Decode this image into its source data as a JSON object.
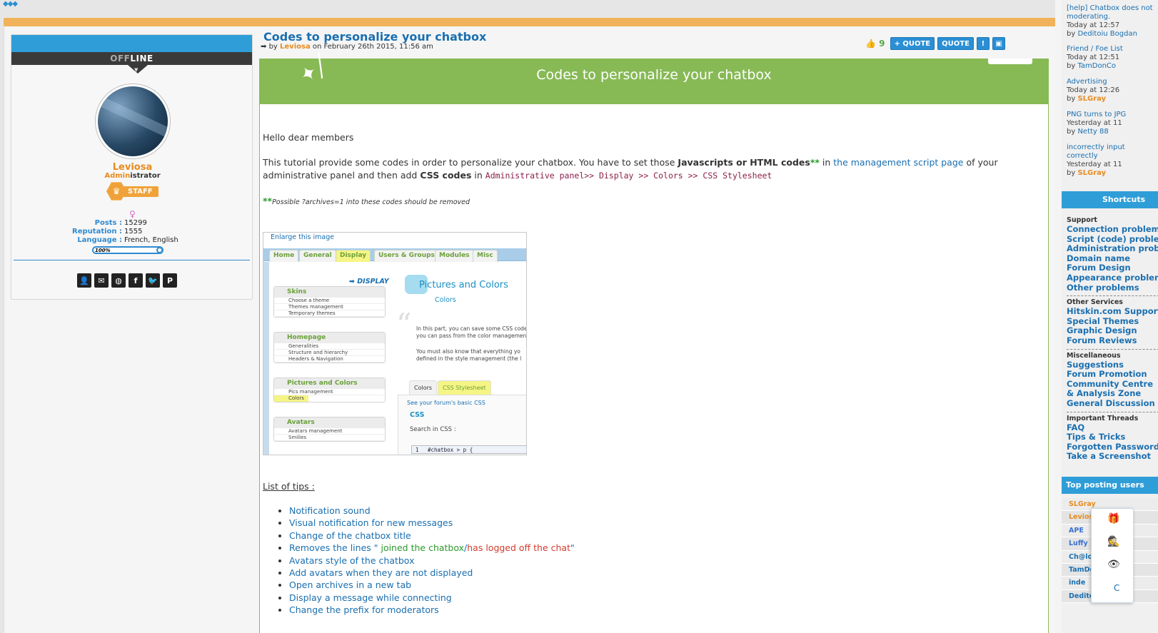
{
  "nav": {
    "arrows": "◆◆◆"
  },
  "profile": {
    "status_prefix": "OFF",
    "status_suffix": "LINE",
    "username": "Leviosa",
    "role_prefix": "Admin",
    "role_suffix": "istrator",
    "badge": "STAFF",
    "gender_symbol": "♀",
    "stats": [
      {
        "key": "Posts :",
        "value": "15299"
      },
      {
        "key": "Reputation :",
        "value": "1555"
      },
      {
        "key": "Language :",
        "value": "French, English"
      }
    ],
    "progress_label": "100%",
    "progress": 1.0,
    "socials": [
      "profile-icon",
      "email-icon",
      "website-icon",
      "facebook-icon",
      "twitter-icon",
      "pinterest-icon"
    ]
  },
  "post": {
    "title": "Codes to personalize your chatbox",
    "meta_by": "by",
    "author": "Leviosa",
    "date": "on February 26th 2015, 11:56 am",
    "like_count": "9",
    "multiquote_label": "+ QUOTE",
    "quote_label": "QUOTE",
    "report_label": "!",
    "banner_title": "Codes to personalize your chatbox",
    "greeting": "Hello dear members",
    "intro_1": "This tutorial provide some codes in order to personalize your chatbox. You have to set those ",
    "intro_bold": "Javascripts or HTML codes",
    "intro_stars": "**",
    "intro_in": " in ",
    "intro_link": "the management script page",
    "intro_2": " of your",
    "intro_3": "administrative panel and then add ",
    "intro_css": "CSS codes",
    "intro_in2": " in ",
    "intro_path": "Administrative panel>> Display >> Colors >> CSS Stylesheet",
    "note_stars": "**",
    "note_1": "Possible ",
    "note_code": "?archives=1",
    "note_2": " into these codes should be removed",
    "tips_heading": "List of tips :",
    "tips": [
      "Notification sound",
      "Visual notification for new messages",
      "Change of the chatbox title",
      "Avatars style of the chatbox",
      "Add avatars when they are not displayed",
      "Open archives in a new tab",
      "Display a message while connecting",
      "Change the prefix for moderators"
    ],
    "tip_removes_1": "Removes the lines \" ",
    "tip_removes_joined": "joined the chatbox",
    "tip_removes_sep": "/",
    "tip_removes_off": "has logged off the chat",
    "tip_removes_end": "\""
  },
  "screenshot": {
    "enlarge": "Enlarge this image",
    "tabs": [
      "Home",
      "General",
      "Display",
      "Users & Groups",
      "Modules",
      "Misc"
    ],
    "display_label": "➡ DISPLAY",
    "sections": [
      {
        "title": "Skins",
        "items": [
          "Choose a theme",
          "Themes management",
          "Temporary themes"
        ]
      },
      {
        "title": "Homepage",
        "items": [
          "Generalities",
          "Structure and hierarchy",
          "Headers & Navigation"
        ]
      },
      {
        "title": "Pictures and Colors",
        "items": [
          "Pics management",
          "Colors"
        ]
      },
      {
        "title": "Avatars",
        "items": [
          "Avatars management",
          "Smilies"
        ]
      }
    ],
    "heading": "Pictures and Colors",
    "sub": "Colors",
    "para1a": "In this part, you can save some CSS code",
    "para1b": "you can pass from the color managemen",
    "para2a": "You must also know that everything yo",
    "para2b": "defined in the style management (the l",
    "subtab1": "Colors",
    "subtab2": "CSS Stylesheet",
    "see_css": "See your forum's basic CSS",
    "css_label": "CSS",
    "search_css": "Search in CSS :",
    "code_line": "#chatbox > p {",
    "line_no": "1"
  },
  "sidebar": {
    "topics": [
      {
        "title": "[help] Chatbox does not moderating.",
        "when": "Today at 12:57",
        "by": "Deditoiu Bogdan",
        "author_color": "blue"
      },
      {
        "title": "Friend / Foe List",
        "when": "Today at 12:51",
        "by": "TamDonCo",
        "author_color": "blue"
      },
      {
        "title": "Advertising",
        "when": "Today at 12:26",
        "by": "SLGray",
        "author_color": "orange"
      },
      {
        "title": "PNG turns to JPG",
        "when": "Yesterday at 11",
        "by": "Netty 88",
        "author_color": "blue"
      },
      {
        "title": "incorrectly input correctly",
        "when": "Yesterday at 11",
        "by": "SLGray",
        "author_color": "orange"
      }
    ],
    "shortcuts_title": "Shortcuts",
    "shortcut_groups": [
      {
        "cat": "Support",
        "links": [
          "Connection problems",
          "Script (code) problems",
          "Administration problems",
          "Domain name",
          "Forum Design",
          "Appearance problems",
          "Other problems"
        ]
      },
      {
        "cat": "Other Services",
        "links": [
          "Hitskin.com Support",
          "Special Themes",
          "Graphic Design",
          "Forum Reviews"
        ]
      },
      {
        "cat": "Miscellaneous",
        "links": [
          "Suggestions",
          "Forum Promotion",
          "Community Centre",
          "& Analysis Zone",
          "General Discussion"
        ]
      },
      {
        "cat": "Important Threads",
        "links": [
          "FAQ",
          "Tips & Tricks",
          "Forgotten Password",
          "Take a Screenshot"
        ]
      }
    ],
    "top_posters_title": "Top posting users",
    "top_posters": [
      {
        "name": "SLGray",
        "color": "#e78b20"
      },
      {
        "name": "Leviosa",
        "color": "#e78b20"
      },
      {
        "name": "APE",
        "color": "#3a6fd0"
      },
      {
        "name": "Luffy",
        "color": "#3a6fd0"
      },
      {
        "name": "Ch@lo",
        "color": "#1a6fb0"
      },
      {
        "name": "TamDonCo",
        "color": "#1a6fb0"
      },
      {
        "name": "inde",
        "color": "#1a6fb0"
      },
      {
        "name": "Deditoiu Bogdan",
        "color": "#1a6fb0"
      }
    ],
    "popup_icons": [
      "gift-icon",
      "incognito-icon",
      "hidden-eye-icon"
    ],
    "popup_label": "C"
  }
}
